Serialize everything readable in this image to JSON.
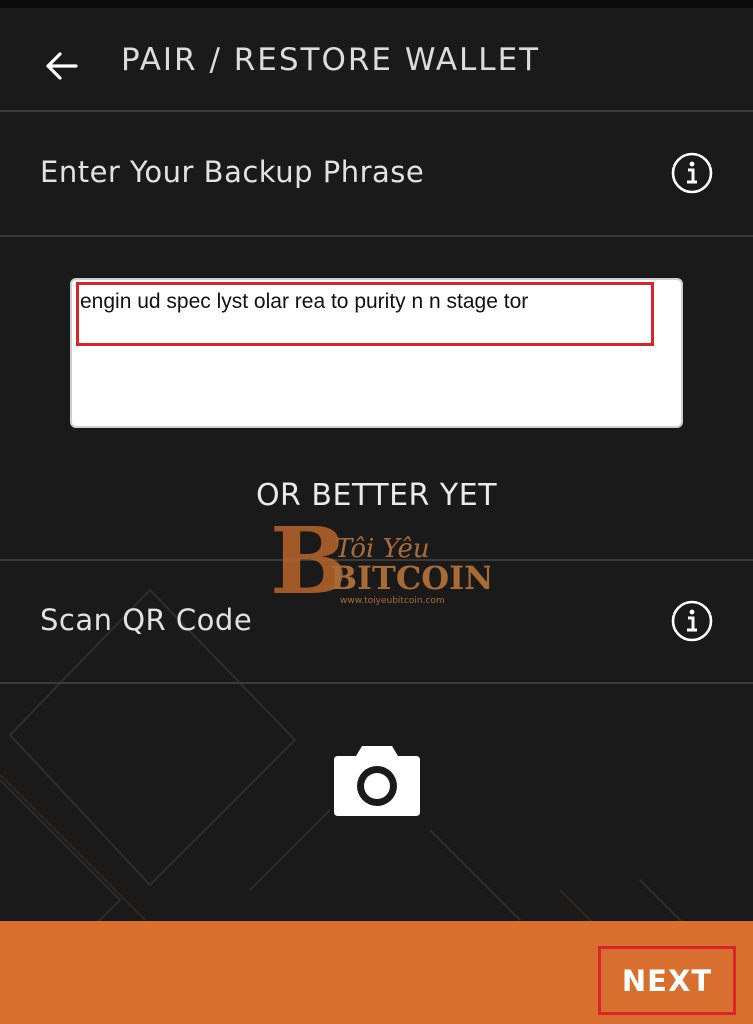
{
  "header": {
    "title": "PAIR / RESTORE WALLET",
    "back_icon": "arrow-left-icon"
  },
  "backup_section": {
    "label": "Enter Your Backup Phrase",
    "info_icon": "info-circle-icon"
  },
  "phrase_input": {
    "value": "engin ud spec lyst olar rea to purity n n stage tor"
  },
  "separator_text": "OR BETTER YET",
  "qr_section": {
    "label": "Scan QR Code",
    "info_icon": "info-circle-icon"
  },
  "camera": {
    "icon": "camera-icon"
  },
  "footer": {
    "next_label": "NEXT"
  },
  "watermark": {
    "line1": "Tôi Yêu",
    "line2": "BITCOIN",
    "line3": "www.toiyeubitcoin.com"
  },
  "colors": {
    "background": "#1a1a1a",
    "accent": "#d96f2e",
    "highlight": "#d9252a"
  }
}
